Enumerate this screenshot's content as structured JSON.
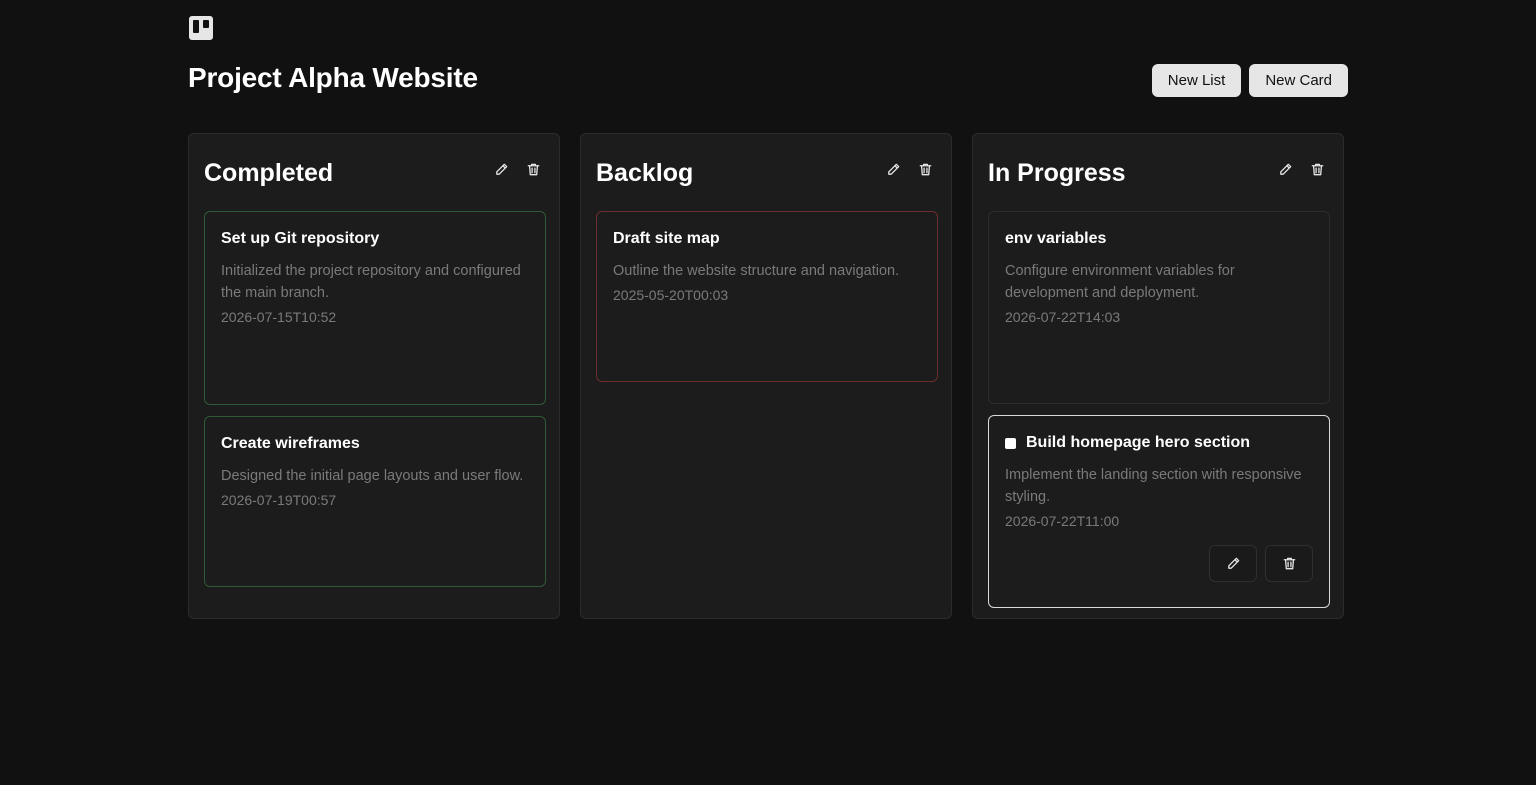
{
  "app": {
    "logo_icon": "board-logo-icon"
  },
  "header": {
    "title": "Project Alpha Website",
    "new_list_label": "New List",
    "new_card_label": "New Card"
  },
  "lists": [
    {
      "title": "Completed",
      "cards": [
        {
          "title": "Set up Git repository",
          "description": "Initialized the project repository and configured the main branch.",
          "date": "2026-07-15T10:52",
          "border": "green"
        },
        {
          "title": "Create wireframes",
          "description": "Designed the initial page layouts and user flow.",
          "date": "2026-07-19T00:57",
          "border": "green"
        }
      ]
    },
    {
      "title": "Backlog",
      "cards": [
        {
          "title": "Draft site map",
          "description": "Outline the website structure and navigation.",
          "date": "2025-05-20T00:03",
          "border": "red"
        }
      ]
    },
    {
      "title": "In Progress",
      "cards": [
        {
          "title": "env variables",
          "description": "Configure environment variables for development and deployment.",
          "date": "2026-07-22T14:03",
          "border": "plain"
        },
        {
          "title": "Build homepage hero section",
          "description": "Implement the landing section with responsive styling.",
          "date": "2026-07-22T11:00",
          "border": "active",
          "checked": false
        }
      ]
    }
  ],
  "colors": {
    "background": "#111111",
    "list_background": "#1c1c1c",
    "completed_border": "#2e5a35",
    "overdue_border": "#6b2e2c",
    "active_border": "#d9d9d9",
    "muted_text": "#7a7a7a"
  },
  "icons": {
    "edit": "pencil-icon",
    "delete": "trash-icon"
  }
}
